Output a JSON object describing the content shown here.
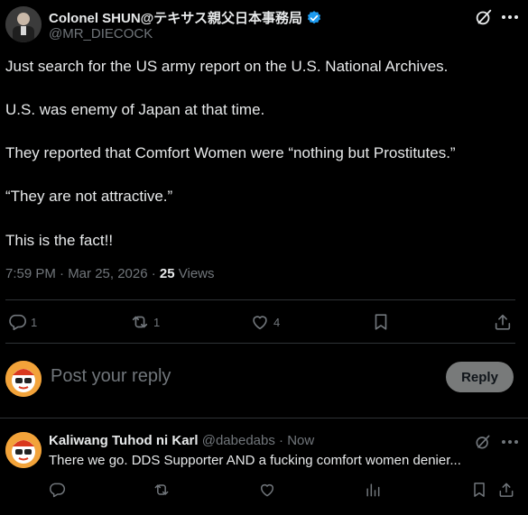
{
  "post": {
    "author_name": "Colonel SHUN@テキサス親父日本事務局",
    "author_handle": "@MR_DIECOCK",
    "paragraphs": [
      "Just search for the US army report on the U.S. National Archives.",
      "U.S. was enemy of Japan at that time.",
      "They reported that Comfort Women were “nothing but Prostitutes.”",
      "“They are not attractive.”",
      "This is the fact!!"
    ],
    "timestamp": "7:59 PM · Mar 25, 2026 · ",
    "views_count": "25",
    "views_label": " Views",
    "stats": {
      "replies": "1",
      "reposts": "1",
      "likes": "4"
    }
  },
  "composer": {
    "placeholder": "Post your reply",
    "reply_button": "Reply"
  },
  "comment": {
    "author_name": "Kaliwang Tuhod ni Karl",
    "author_handle": "@dabedabs",
    "time": " · Now",
    "text": "There we go. DDS Supporter AND a fucking comfort women denier..."
  },
  "colors": {
    "background": "#000000",
    "text": "#e7e9ea",
    "muted": "#71767b",
    "verified": "#1d9bf0",
    "divider": "#2f3336",
    "reply_button_bg": "#787a7a"
  },
  "icons": {
    "verified": "verified-badge-icon",
    "grok": "grok-icon",
    "more": "more-icon",
    "reply": "reply-icon",
    "repost": "repost-icon",
    "like": "heart-icon",
    "bookmark": "bookmark-icon",
    "share": "share-icon",
    "views": "analytics-icon"
  }
}
